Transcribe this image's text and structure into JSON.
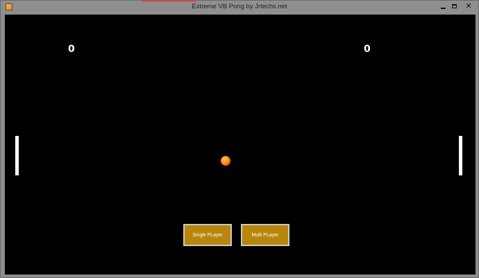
{
  "window": {
    "title": "Extreme VB Pong by Jrtechs.net",
    "controls": {
      "minimize_icon": "minimize-icon",
      "maximize_icon": "maximize-icon",
      "close_label": "✕"
    }
  },
  "game": {
    "background_color": "#000000",
    "score_left": "0",
    "score_right": "0",
    "ball_color": "#ff8a1a",
    "paddle_color": "#ffffff"
  },
  "buttons": {
    "single_player": "Single PLayer",
    "multi_player": "Multi PLayer",
    "button_color": "#b8860b"
  }
}
